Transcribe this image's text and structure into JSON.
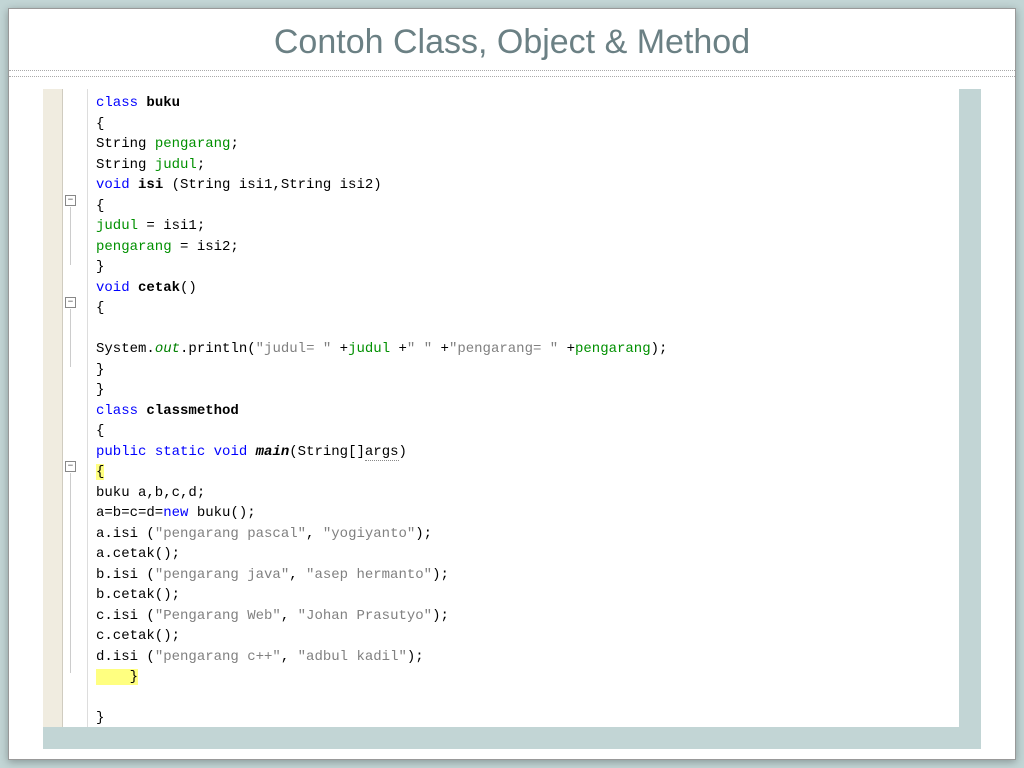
{
  "title": "Contoh Class, Object & Method",
  "code": {
    "l1_kw": "class",
    "l1_name": "buku",
    "l2": "{",
    "l3a": "String ",
    "l3b": "pengarang",
    "l3c": ";",
    "l4a": "String ",
    "l4b": "judul",
    "l4c": ";",
    "l5a": "void",
    "l5b": " isi ",
    "l5c": "(String isi1,String isi2)",
    "l6": "{",
    "l7a": "judul",
    "l7b": " = isi1;",
    "l8a": "pengarang",
    "l8b": " = isi2;",
    "l9": "}",
    "l10a": "void",
    "l10b": " cetak",
    "l10c": "()",
    "l11": "{",
    "l12": "",
    "l13a": "System.",
    "l13b": "out",
    "l13c": ".println(",
    "l13d": "\"judul= \"",
    "l13e": " +",
    "l13f": "judul",
    "l13g": " +",
    "l13h": "\" \"",
    "l13i": " +",
    "l13j": "\"pengarang= \"",
    "l13k": " +",
    "l13l": "pengarang",
    "l13m": ");",
    "l14": "}",
    "l15": "}",
    "l16a": "class",
    "l16b": " classmethod",
    "l17": "{",
    "l18a": "public",
    "l18b": " static",
    "l18c": " void",
    "l18d": " main",
    "l18e": "(String[]",
    "l18f": "args",
    "l18g": ")",
    "l19": "{",
    "l20": "buku a,b,c,d;",
    "l21a": "a=b=c=d=",
    "l21b": "new",
    "l21c": " buku();",
    "l22a": "a.isi (",
    "l22b": "\"pengarang pascal\"",
    "l22c": ", ",
    "l22d": "\"yogiyanto\"",
    "l22e": ");",
    "l23": "a.cetak();",
    "l24a": "b.isi (",
    "l24b": "\"pengarang java\"",
    "l24c": ", ",
    "l24d": "\"asep hermanto\"",
    "l24e": ");",
    "l25": "b.cetak();",
    "l26a": "c.isi (",
    "l26b": "\"Pengarang Web\"",
    "l26c": ", ",
    "l26d": "\"Johan Prasutyo\"",
    "l26e": ");",
    "l27": "c.cetak();",
    "l28a": "d.isi (",
    "l28b": "\"pengarang c++\"",
    "l28c": ", ",
    "l28d": "\"adbul kadil\"",
    "l28e": ");",
    "l29": "    }",
    "l30": "",
    "l31": "}"
  },
  "fold_symbol": "−"
}
